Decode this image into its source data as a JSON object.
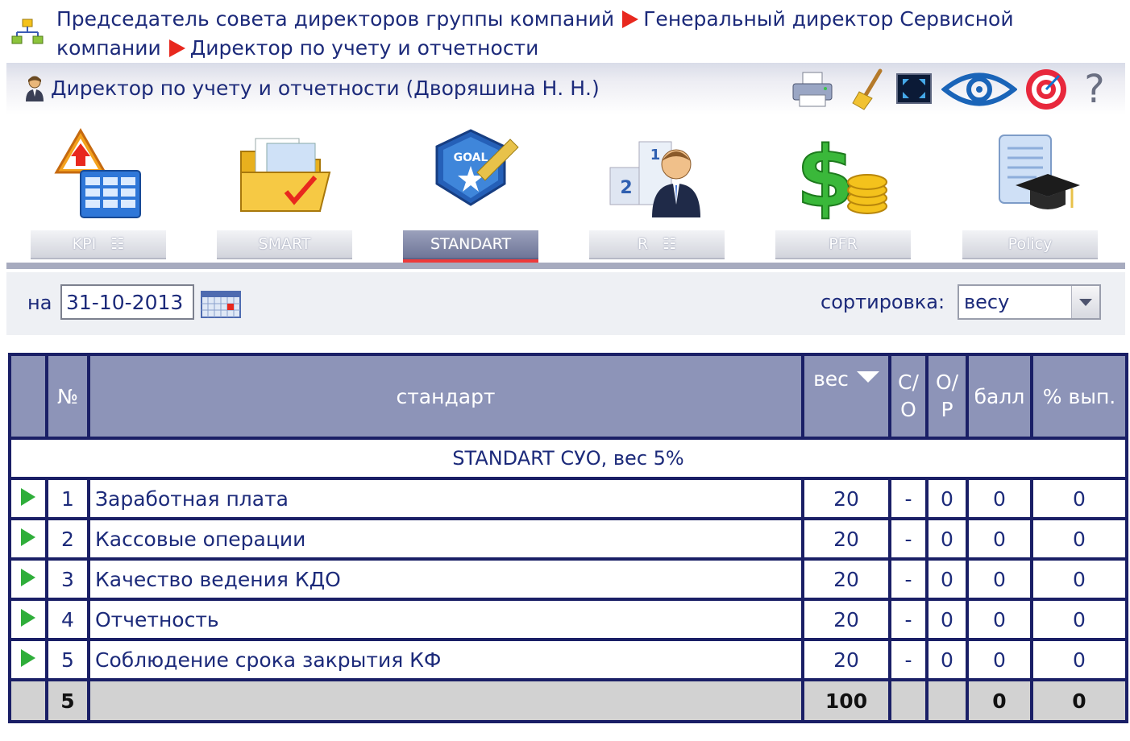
{
  "breadcrumb": {
    "items": [
      "Председатель совета директоров группы компаний",
      "Генеральный директор Сервисной компании",
      "Директор по учету и отчетности"
    ]
  },
  "header": {
    "title": "Директор по учету и отчетности  (Дворяшина Н. Н.)"
  },
  "toolbar": {
    "icons": [
      "printer-icon",
      "broom-icon",
      "fullscreen-icon",
      "eye-icon",
      "target-icon",
      "help-icon"
    ],
    "help_symbol": "?"
  },
  "modules": [
    {
      "label": "KPI",
      "icon": "kpi-icon"
    },
    {
      "label": "SMART",
      "icon": "folder-icon"
    },
    {
      "label": "STANDART",
      "icon": "goal-icon",
      "active": true
    },
    {
      "label": "R",
      "icon": "ranking-icon"
    },
    {
      "label": "PFR",
      "icon": "money-icon"
    },
    {
      "label": "Policy",
      "icon": "diploma-icon"
    }
  ],
  "filter": {
    "date_label": "на",
    "date_value": "31-10-2013",
    "sort_label": "сортировка:",
    "sort_value": "весу"
  },
  "table": {
    "columns": {
      "num": "№",
      "standard": "стандарт",
      "weight": "вес",
      "co_1": "С/",
      "co_2": "О",
      "op_1": "О/",
      "op_2": "Р",
      "score": "балл",
      "pct": "% вып."
    },
    "group_title": "STANDART СУО, вес 5%",
    "rows": [
      {
        "num": "1",
        "name": "Заработная плата",
        "weight": "20",
        "co": "-",
        "op": "0",
        "score": "0",
        "pct": "0"
      },
      {
        "num": "2",
        "name": "Кассовые операции",
        "weight": "20",
        "co": "-",
        "op": "0",
        "score": "0",
        "pct": "0"
      },
      {
        "num": "3",
        "name": "Качество ведения КДО",
        "weight": "20",
        "co": "-",
        "op": "0",
        "score": "0",
        "pct": "0"
      },
      {
        "num": "4",
        "name": "Отчетность",
        "weight": "20",
        "co": "-",
        "op": "0",
        "score": "0",
        "pct": "0"
      },
      {
        "num": "5",
        "name": "Соблюдение срока закрытия КФ",
        "weight": "20",
        "co": "-",
        "op": "0",
        "score": "0",
        "pct": "0"
      }
    ],
    "total": {
      "num": "5",
      "weight": "100",
      "score": "0",
      "pct": "0"
    }
  },
  "colors": {
    "text": "#1c2a7a",
    "header_bg": "#8d94b8",
    "border": "#1a1f66",
    "active_underline": "#ee3a3a",
    "play": "#2fae3a"
  }
}
